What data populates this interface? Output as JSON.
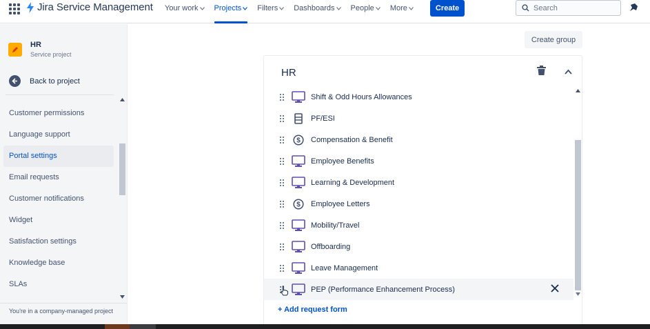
{
  "topnav": {
    "brand": "Jira Service Management",
    "items": [
      {
        "label": "Your work",
        "active": false
      },
      {
        "label": "Projects",
        "active": true
      },
      {
        "label": "Filters",
        "active": false
      },
      {
        "label": "Dashboards",
        "active": false
      },
      {
        "label": "People",
        "active": false
      },
      {
        "label": "More",
        "active": false
      }
    ],
    "create_label": "Create",
    "search_placeholder": "Search"
  },
  "sidebar": {
    "project_name": "HR",
    "project_type": "Service project",
    "back_label": "Back to project",
    "items": [
      {
        "label": "Customer permissions",
        "active": false
      },
      {
        "label": "Language support",
        "active": false
      },
      {
        "label": "Portal settings",
        "active": true
      },
      {
        "label": "Email requests",
        "active": false
      },
      {
        "label": "Customer notifications",
        "active": false
      },
      {
        "label": "Widget",
        "active": false
      },
      {
        "label": "Satisfaction settings",
        "active": false
      },
      {
        "label": "Knowledge base",
        "active": false
      },
      {
        "label": "SLAs",
        "active": false
      }
    ],
    "footer": "You're in a company-managed project"
  },
  "main": {
    "create_group_label": "Create group",
    "group": {
      "title": "HR",
      "forms": [
        {
          "label": "Shift & Odd Hours Allowances",
          "icon": "monitor-icon"
        },
        {
          "label": "PF/ESI",
          "icon": "server-icon"
        },
        {
          "label": "Compensation & Benefit",
          "icon": "dollar-circle-icon"
        },
        {
          "label": "Employee Benefits",
          "icon": "monitor-icon"
        },
        {
          "label": "Learning & Development",
          "icon": "monitor-icon"
        },
        {
          "label": "Employee Letters",
          "icon": "dollar-circle-icon"
        },
        {
          "label": "Mobility/Travel",
          "icon": "monitor-icon"
        },
        {
          "label": "Offboarding",
          "icon": "monitor-icon"
        },
        {
          "label": "Leave Management",
          "icon": "monitor-icon"
        },
        {
          "label": "PEP (Performance Enhancement Process)",
          "icon": "monitor-icon"
        }
      ],
      "hovered_index": 9,
      "add_form_label": "+ Add request form"
    }
  },
  "colors": {
    "primary": "#0052cc",
    "icon_purple": "#5e4db2",
    "sidebar_bg": "#f4f5f7",
    "project_avatar": "#ffab00"
  }
}
